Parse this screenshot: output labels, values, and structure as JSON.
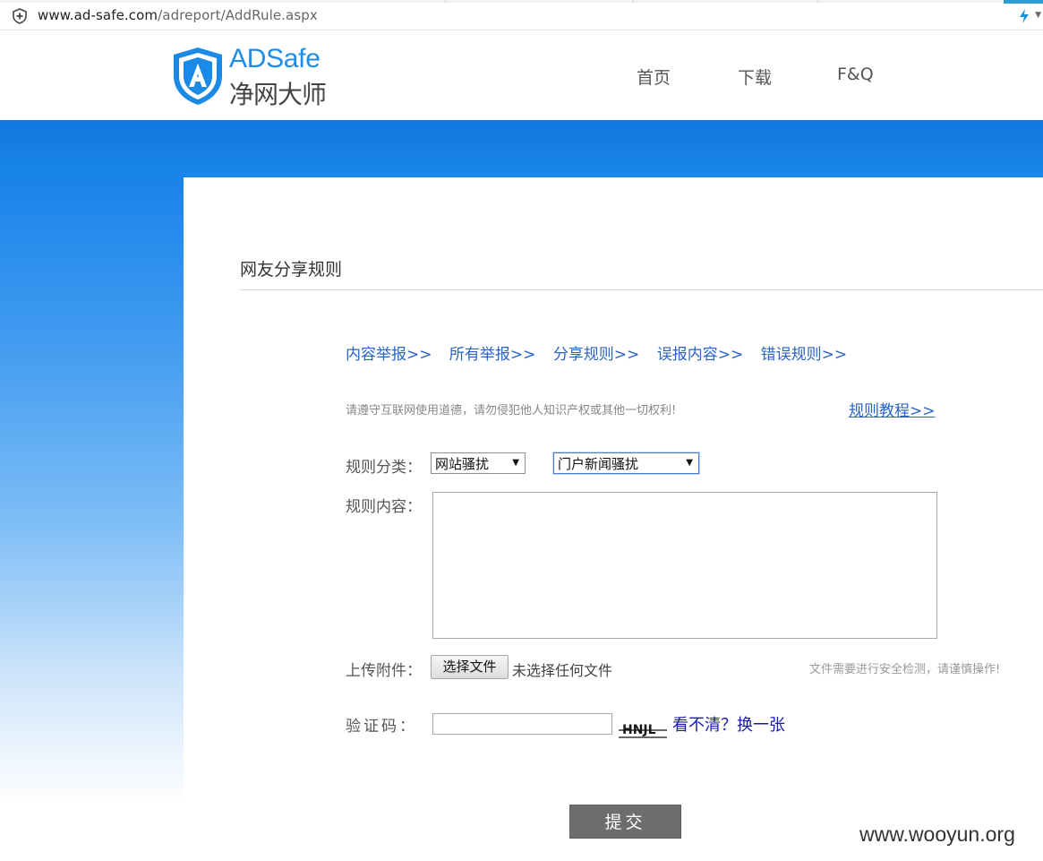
{
  "browser": {
    "url_host": "www.ad-safe.com",
    "url_path": "/adreport/AddRule.aspx"
  },
  "header": {
    "logo_en": "ADSafe",
    "logo_cn": "净网大师",
    "nav": [
      {
        "label": "首页"
      },
      {
        "label": "下载"
      },
      {
        "label": "F&Q"
      }
    ]
  },
  "main": {
    "page_title": "网友分享规则",
    "tabs": [
      {
        "label": "内容举报>>"
      },
      {
        "label": "所有举报>>"
      },
      {
        "label": "分享规则>>"
      },
      {
        "label": "误报内容>>"
      },
      {
        "label": "错误规则>>"
      }
    ],
    "notice": "请遵守互联网使用道德，请勿侵犯他人知识产权或其他一切权利!",
    "tutorial_link": "规则教程>>",
    "form": {
      "category_label": "规则分类：",
      "category_value": "网站骚扰",
      "subcategory_value": "门户新闻骚扰",
      "content_label": "规则内容：",
      "content_value": "",
      "upload_label": "上传附件：",
      "file_button": "选择文件",
      "file_status": "未选择任何文件",
      "file_hint": "文件需要进行安全检测，请谨慎操作!",
      "captcha_label": "验证码：",
      "captcha_text": "HNJL",
      "captcha_refresh": "看不清？换一张",
      "submit_label": "提交"
    }
  },
  "watermark": "www.wooyun.org",
  "colors": {
    "brand_blue": "#1e8ce8",
    "link_blue": "#2a64c4",
    "banner_blue": "#1078e0",
    "submit_gray": "#6d6d6d"
  }
}
